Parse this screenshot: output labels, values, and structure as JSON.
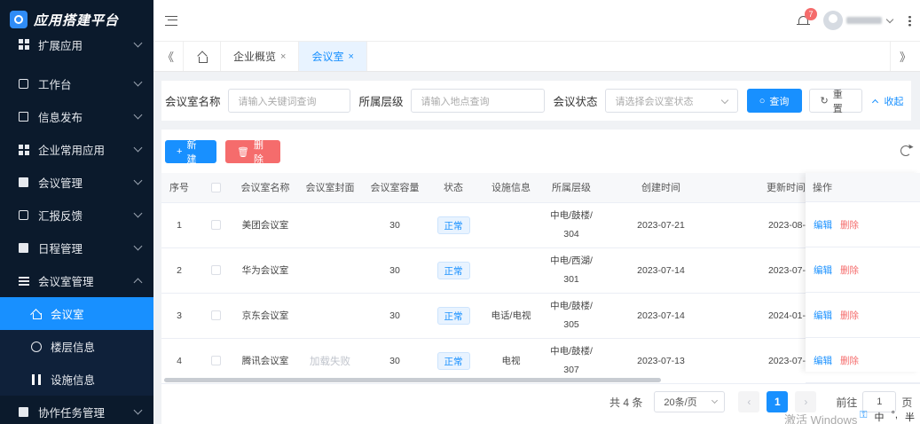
{
  "brand": {
    "title": "应用搭建平台"
  },
  "sidebar": {
    "items": [
      {
        "label": "扩展应用",
        "icon": "grid-icon"
      },
      {
        "label": "工作台",
        "icon": "square-icon"
      },
      {
        "label": "信息发布",
        "icon": "document-icon"
      },
      {
        "label": "企业常用应用",
        "icon": "table-icon"
      },
      {
        "label": "会议管理",
        "icon": "list-icon"
      },
      {
        "label": "汇报反馈",
        "icon": "edit-icon"
      },
      {
        "label": "日程管理",
        "icon": "calendar-icon"
      },
      {
        "label": "会议室管理",
        "icon": "menu-icon"
      }
    ],
    "sub_items": [
      {
        "label": "会议室",
        "icon": "home-icon"
      },
      {
        "label": "楼层信息",
        "icon": "circle-check-icon"
      },
      {
        "label": "设施信息",
        "icon": "bars-icon"
      }
    ],
    "last_item": {
      "label": "协作任务管理",
      "icon": "document-icon"
    }
  },
  "header": {
    "badge_count": "7"
  },
  "tabs": {
    "prev": "《",
    "next": "》",
    "items": [
      {
        "label": "企业概览",
        "close": "×"
      },
      {
        "label": "会议室",
        "close": "×"
      }
    ]
  },
  "search": {
    "name_label": "会议室名称",
    "name_placeholder": "请输入关键词查询",
    "floor_label": "所属层级",
    "floor_placeholder": "请输入地点查询",
    "status_label": "会议状态",
    "status_placeholder": "请选择会议室状态",
    "query_button": "查询",
    "query_icon": "search-icon",
    "reset_button": "重置",
    "collapse_link": "收起"
  },
  "toolbar": {
    "new_button": "新建",
    "delete_button": "删除"
  },
  "table": {
    "headers": [
      "序号",
      "",
      "会议室名称",
      "会议室封面",
      "会议室容量",
      "状态",
      "设施信息",
      "所属层级",
      "创建时间",
      "更新时间",
      "操作"
    ],
    "rows": [
      {
        "index": "1",
        "name": "美团会议室",
        "cover": "",
        "capacity": "30",
        "status": "正常",
        "facility": "",
        "floor_line1": "中电/鼓楼/",
        "floor_line2": "304",
        "created": "2023-07-21",
        "updated": "2023-08-"
      },
      {
        "index": "2",
        "name": "华为会议室",
        "cover": "",
        "capacity": "30",
        "status": "正常",
        "facility": "",
        "floor_line1": "中电/西湖/",
        "floor_line2": "301",
        "created": "2023-07-14",
        "updated": "2023-07-"
      },
      {
        "index": "3",
        "name": "京东会议室",
        "cover": "",
        "capacity": "30",
        "status": "正常",
        "facility": "电话/电视",
        "floor_line1": "中电/鼓楼/",
        "floor_line2": "305",
        "created": "2023-07-14",
        "updated": "2024-01-"
      },
      {
        "index": "4",
        "name": "腾讯会议室",
        "cover": "加载失败",
        "capacity": "30",
        "status": "正常",
        "facility": "电视",
        "floor_line1": "中电/鼓楼/",
        "floor_line2": "307",
        "created": "2023-07-13",
        "updated": "2023-07-"
      }
    ],
    "ops_header": "操作",
    "edit_label": "编辑",
    "delete_label": "删除"
  },
  "pagination": {
    "total": "共 4 条",
    "page_size": "20条/页",
    "prev": "‹",
    "current": "1",
    "next": "›",
    "goto_label": "前往",
    "goto_value": "1",
    "goto_suffix": "页"
  },
  "system": {
    "watermark": "激活 Windows",
    "ime": [
      "中",
      "°,",
      "半"
    ]
  }
}
